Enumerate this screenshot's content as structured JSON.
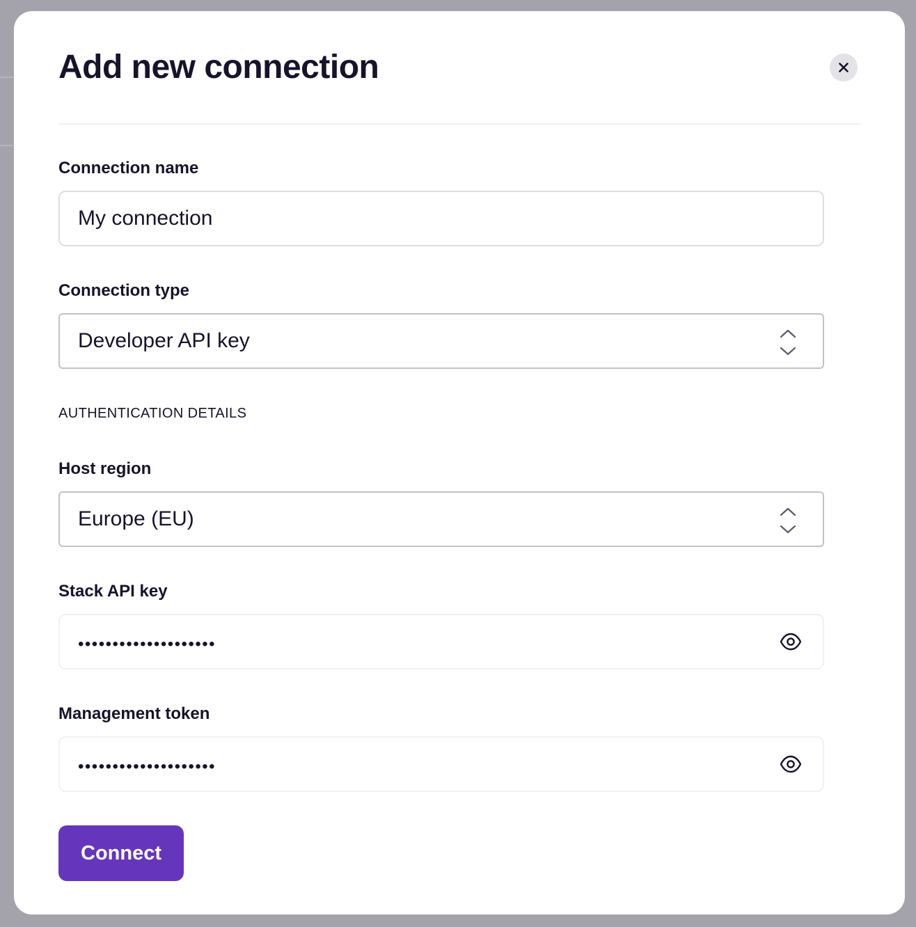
{
  "modal": {
    "title": "Add new connection"
  },
  "form": {
    "connection_name": {
      "label": "Connection name",
      "value": "My connection"
    },
    "connection_type": {
      "label": "Connection type",
      "selected": "Developer API key"
    },
    "section_caption": "AUTHENTICATION DETAILS",
    "host_region": {
      "label": "Host region",
      "selected": "Europe (EU)"
    },
    "stack_api_key": {
      "label": "Stack API key",
      "masked_value": "••••••••••••••••••••"
    },
    "management_token": {
      "label": "Management token",
      "masked_value": "••••••••••••••••••••"
    },
    "submit_label": "Connect"
  },
  "icons": {
    "close": "close-icon",
    "select": "chevron-up-down-icon",
    "reveal": "eye-icon"
  },
  "colors": {
    "primary": "#6535bb",
    "text": "#16132b",
    "overlay": "#a4a2aa",
    "close_bg": "#e3e2e7"
  }
}
